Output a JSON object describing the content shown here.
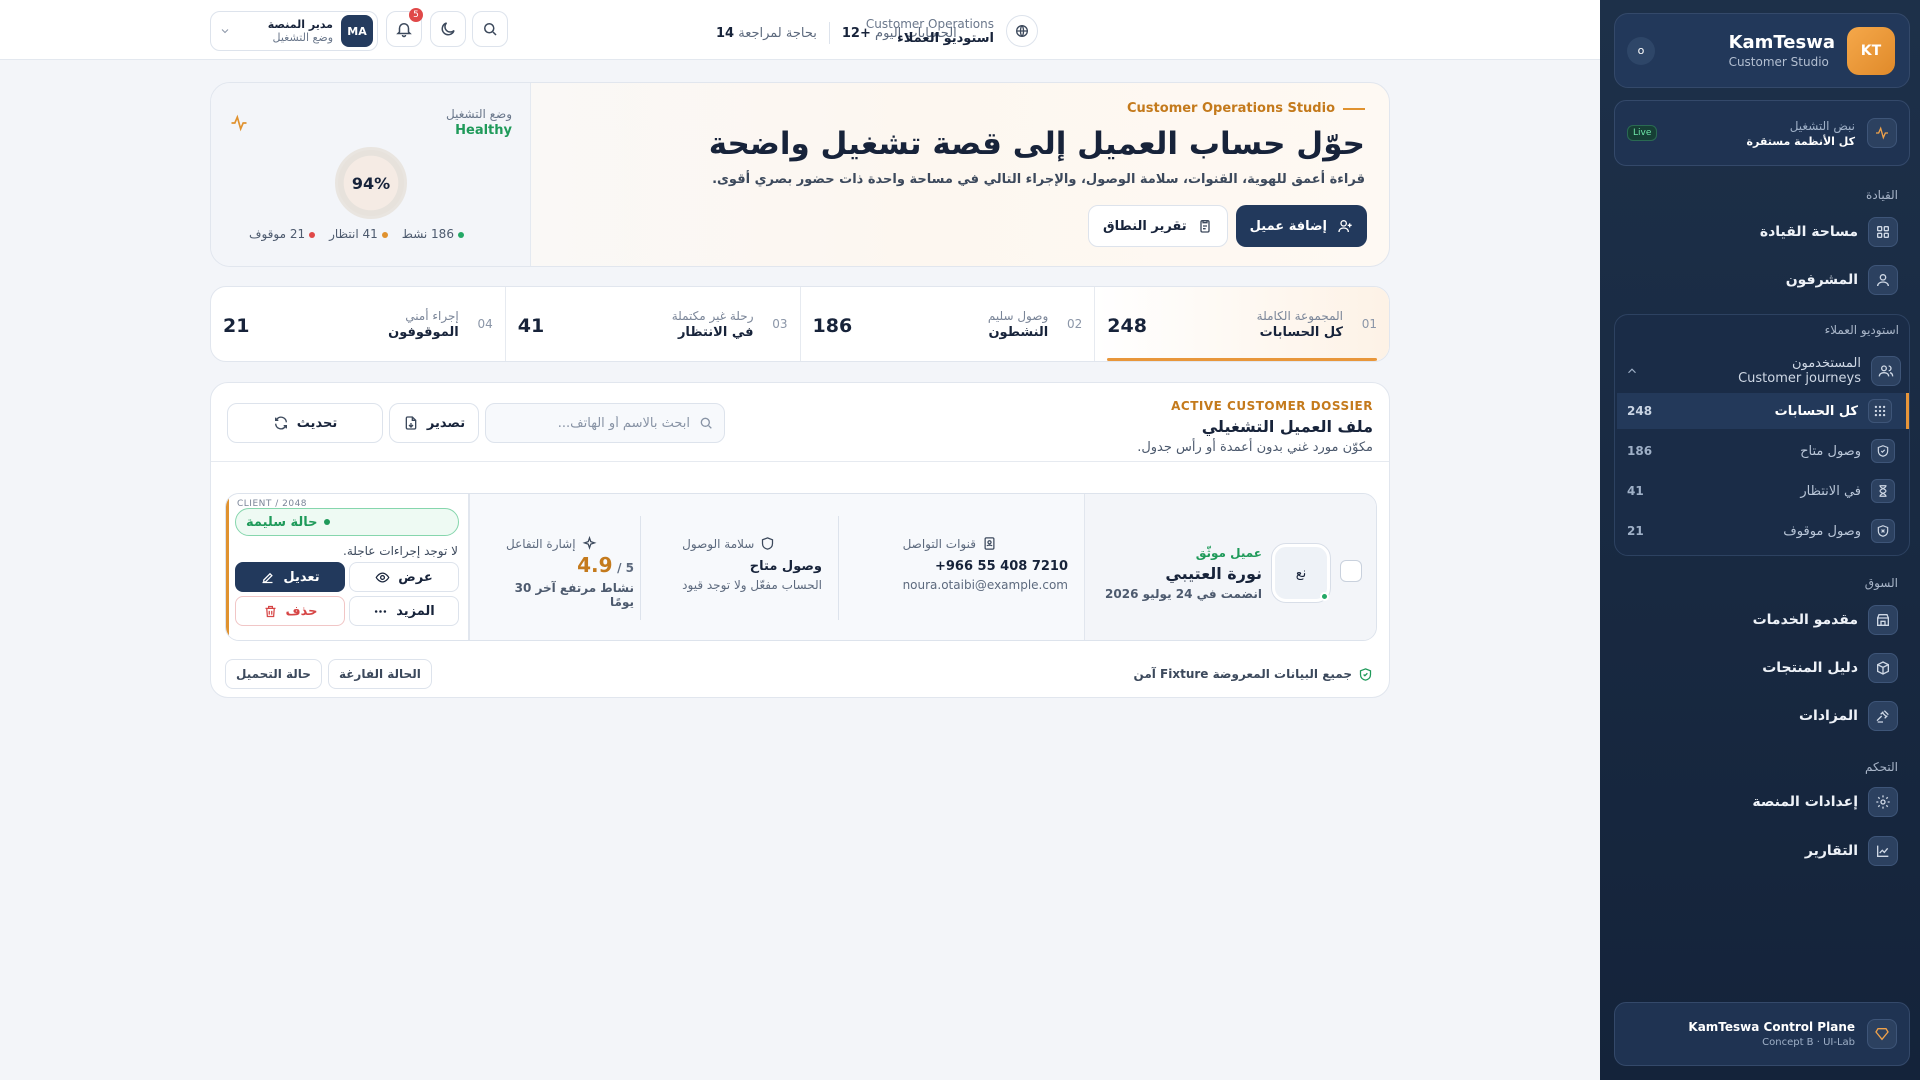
{
  "sidebar": {
    "brand_name": "KamTeswa",
    "brand_sub": "Customer Studio",
    "brand_initials": "KT",
    "brand_dot": "o",
    "pulse_title": "نبض التشغيل",
    "pulse_status": "كل الأنظمة مستقرة",
    "pulse_badge": "Live",
    "section_leadership": "القيادة",
    "nav_dashboard": "مساحة القيادة",
    "nav_supervisors": "المشرفون",
    "studio_title": "استوديو العملاء",
    "group_users": "المستخدمون",
    "group_journeys": "Customer journeys",
    "sub_items": [
      {
        "label": "كل الحسابات",
        "count": "248"
      },
      {
        "label": "وصول متاح",
        "count": "186"
      },
      {
        "label": "في الانتظار",
        "count": "41"
      },
      {
        "label": "وصول موقوف",
        "count": "21"
      }
    ],
    "section_market": "السوق",
    "nav_providers": "مقدمو الخدمات",
    "nav_products": "دليل المنتجات",
    "nav_auctions": "المزادات",
    "section_control": "التحكم",
    "nav_settings": "إعدادات المنصة",
    "nav_reports": "التقارير",
    "footer_title": "KamTeswa Control Plane",
    "footer_sub": "Concept B · UI-Lab"
  },
  "topbar": {
    "workspace_en": "Customer Operations",
    "workspace_ar": "استوديو العملاء",
    "kpi_today_label": "الحسابات اليوم",
    "kpi_today_value": "+12",
    "kpi_review_label": "بحاجة لمراجعة",
    "kpi_review_value": "14",
    "notif_count": "5",
    "profile_role": "مدير المنصة",
    "profile_mode": "وضع التشغيل",
    "profile_initials": "MA"
  },
  "hero": {
    "eyebrow": "Customer Operations Studio",
    "title": "حوّل حساب العميل إلى قصة تشغيل واضحة",
    "lead": "قراءة أعمق للهوية، القنوات، سلامة الوصول، والإجراء التالي في مساحة واحدة ذات حضور بصري أقوى.",
    "btn_add": "إضافة عميل",
    "btn_report": "تقرير النطاق",
    "mode_label": "وضع التشغيل",
    "mode_value": "Healthy",
    "health_percent": "94%",
    "stat_active": "186 نشط",
    "stat_waiting": "41 انتظار",
    "stat_stopped": "21 موقوف"
  },
  "tabs": [
    {
      "num": "01",
      "kicker": "المجموعة الكاملة",
      "label": "كل الحسابات",
      "value": "248"
    },
    {
      "num": "02",
      "kicker": "وصول سليم",
      "label": "النشطون",
      "value": "186"
    },
    {
      "num": "03",
      "kicker": "رحلة غير مكتملة",
      "label": "في الانتظار",
      "value": "41"
    },
    {
      "num": "04",
      "kicker": "إجراء أمني",
      "label": "الموقوفون",
      "value": "21"
    }
  ],
  "dossier": {
    "eyebrow": "ACTIVE CUSTOMER DOSSIER",
    "title": "ملف العميل التشغيلي",
    "subtitle": "مكوّن مورد غني بدون أعمدة أو رأس جدول.",
    "search_placeholder": "ابحث بالاسم أو الهاتف...",
    "export_label": "تصدير",
    "refresh_label": "تحديث",
    "customer": {
      "trust": "عميل موثّق",
      "name": "نورة العتيبي",
      "joined": "انضمت في 24 يوليو 2026",
      "initials": "نع",
      "channels_label": "قنوات التواصل",
      "phone": "+966 55 408 7210",
      "email": "noura.otaibi@example.com",
      "access_label": "سلامة الوصول",
      "access_value": "وصول متاح",
      "access_note": "الحساب مفعّل ولا توجد قيود",
      "signal_label": "إشارة التفاعل",
      "rating": "4.9",
      "rating_max": "/ 5",
      "signal_note": "نشاط مرتفع آخر 30 يومًا",
      "client_id": "CLIENT / 2048",
      "status": "حالة سليمة",
      "no_action": "لا توجد إجراءات عاجلة.",
      "btn_view": "عرض",
      "btn_edit": "تعديل",
      "btn_more": "المزيد",
      "btn_delete": "حذف"
    },
    "safe_note": "جميع البيانات المعروضة Fixture آمن",
    "chip_empty": "الحالة الفارغة",
    "chip_loading": "حالة التحميل"
  },
  "colors": {
    "accent": "#e8963a",
    "navy": "#22395c",
    "success": "#1f9a5a",
    "danger": "#d64545"
  }
}
